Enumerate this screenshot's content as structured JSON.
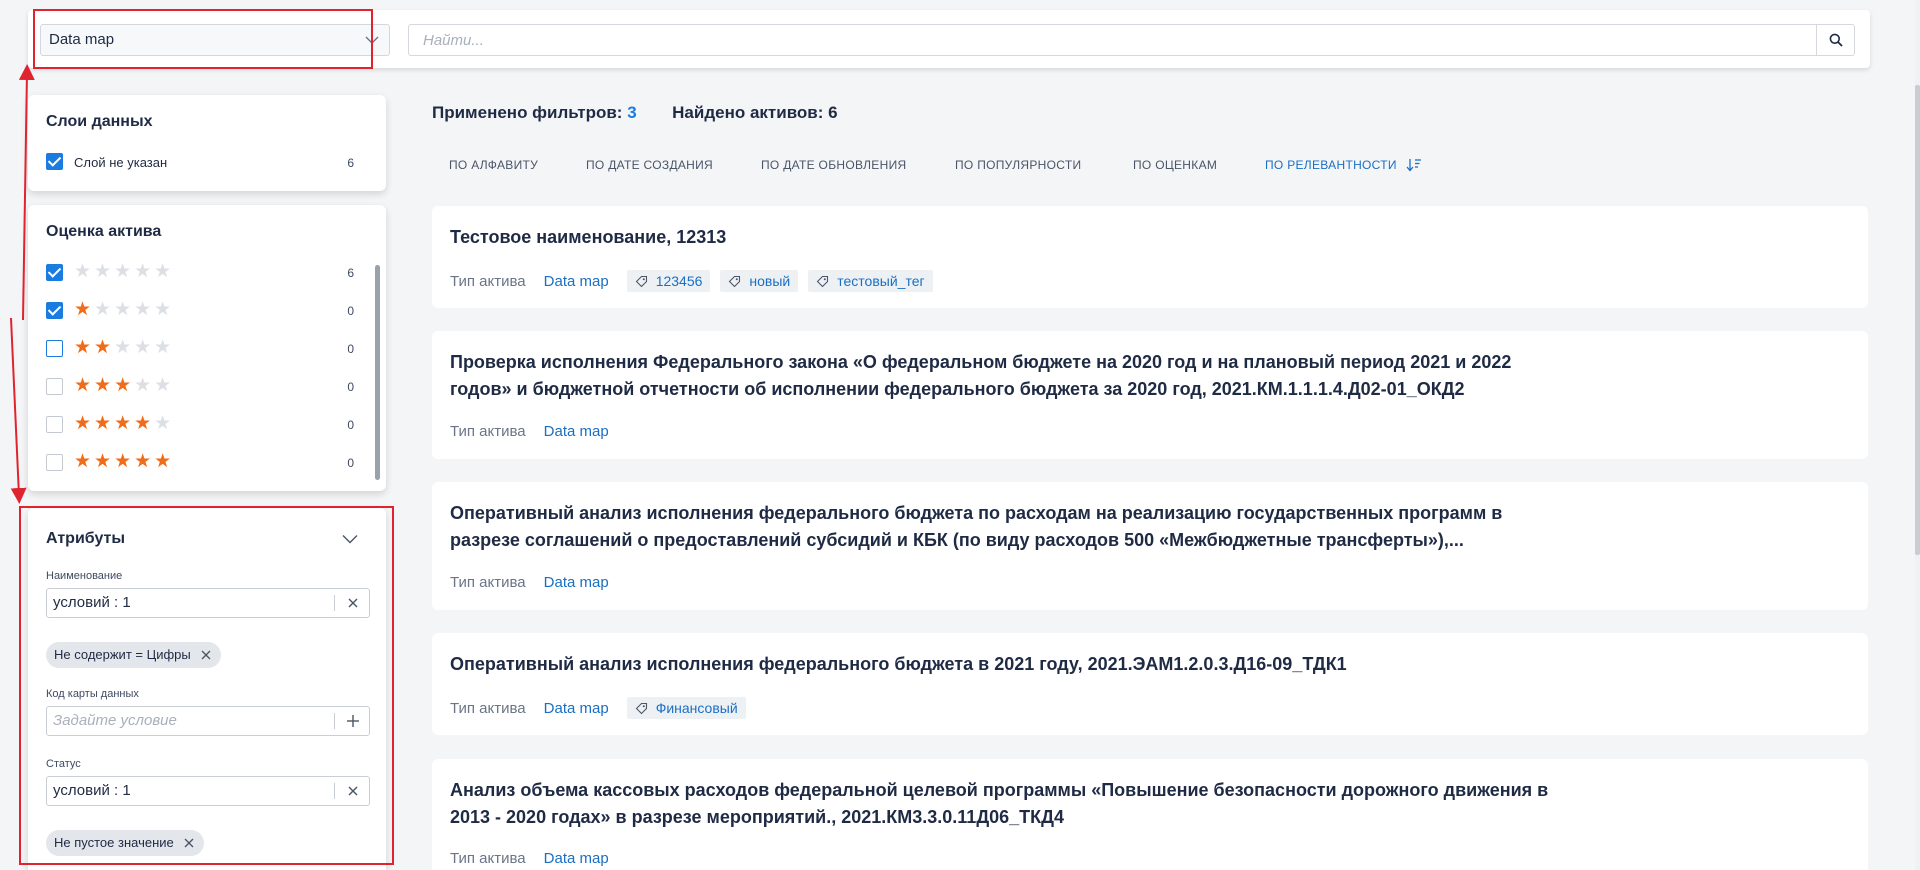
{
  "topbar": {
    "asset_type_value": "Data map",
    "search_placeholder": "Найти..."
  },
  "layers": {
    "title": "Слои данных",
    "items": [
      {
        "label": "Слой не указан",
        "count": "6",
        "checked": true
      }
    ]
  },
  "rating": {
    "title": "Оценка актива",
    "items": [
      {
        "stars": 0,
        "count": "6",
        "checked": true
      },
      {
        "stars": 1,
        "count": "0",
        "checked": true
      },
      {
        "stars": 2,
        "count": "0",
        "checked": false
      },
      {
        "stars": 3,
        "count": "0",
        "checked": false
      },
      {
        "stars": 4,
        "count": "0",
        "checked": false
      },
      {
        "stars": 5,
        "count": "0",
        "checked": false
      }
    ],
    "star_color": "#ef6c1a"
  },
  "attributes": {
    "title": "Атрибуты",
    "name_label": "Наименование",
    "name_value": "условий : 1",
    "name_chip": "Не содержит = Цифры",
    "code_label": "Код карты данных",
    "code_placeholder": "Задайте условие",
    "status_label": "Статус",
    "status_value": "условий : 1",
    "status_chip": "Не пустое значение"
  },
  "summary": {
    "filters_label": "Применено фильтров:",
    "filters_count": "3",
    "found_label": "Найдено активов: 6"
  },
  "sort": {
    "items": [
      "ПО АЛФАВИТУ",
      "ПО ДАТЕ СОЗДАНИЯ",
      "ПО ДАТЕ ОБНОВЛЕНИЯ",
      "ПО ПОПУЛЯРНОСТИ",
      "ПО ОЦЕНКАМ",
      "ПО РЕЛЕВАНТНОСТИ"
    ],
    "active": "ПО РЕЛЕВАНТНОСТИ"
  },
  "results": [
    {
      "title": "Тестовое наименование, 12313",
      "type_label": "Тип актива",
      "type_value": "Data map",
      "tags": [
        "123456",
        "новый",
        "тестовый_тег"
      ]
    },
    {
      "title": "Проверка исполнения Федерального закона «О федеральном бюджете на 2020 год и на плановый период 2021 и 2022 годов» и бюджетной отчетности об исполнении федерального бюджета за 2020 год, 2021.КМ.1.1.1.4.Д02-01_ОКД2",
      "type_label": "Тип актива",
      "type_value": "Data map",
      "tags": []
    },
    {
      "title": "Оперативный анализ исполнения федерального бюджета по расходам на реализацию государственных программ в разрезе соглашений о предоставлений субсидий и КБК (по виду расходов 500 «Межбюджетные трансферты»),...",
      "type_label": "Тип актива",
      "type_value": "Data map",
      "tags": []
    },
    {
      "title": "Оперативный анализ исполнения федерального бюджета в 2021 году, 2021.ЭАМ1.2.0.3.Д16-09_ТДК1",
      "type_label": "Тип актива",
      "type_value": "Data map",
      "tags": [
        "Финансовый"
      ]
    },
    {
      "title": "Анализ объема кассовых расходов федеральной целевой программы «Повышение безопасности дорожного движения в 2013 - 2020 годах» в разрезе мероприятий., 2021.КМ3.3.0.11Д06_ТКД4",
      "type_label": "Тип актива",
      "type_value": "Data map",
      "tags": []
    }
  ],
  "colors": {
    "accent": "#1a7be0",
    "link": "#1a6fc4",
    "annotation_red": "#e0242f"
  }
}
